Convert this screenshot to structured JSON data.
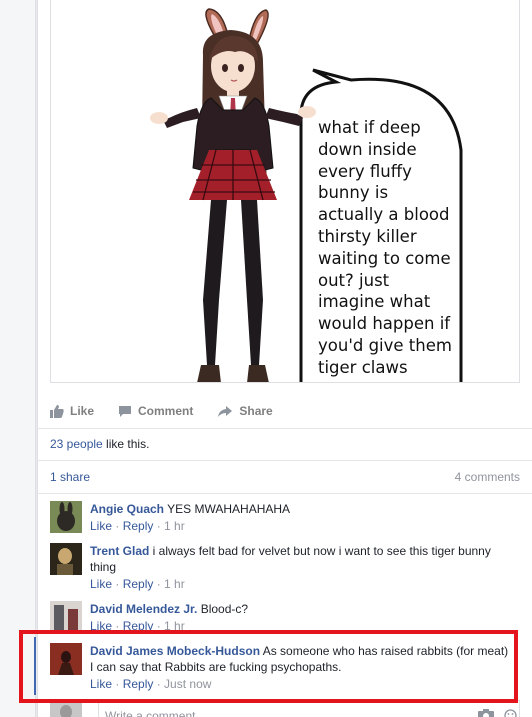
{
  "post": {
    "speech_bubble_lines": [
      "what if deep",
      "down inside",
      "every fluffy",
      "bunny is",
      "actually a blood",
      "thirsty killer",
      "waiting to come",
      "out? just",
      "imagine what",
      "would happen if",
      "you'd give them",
      "tiger claws"
    ]
  },
  "actions": {
    "like": "Like",
    "comment": "Comment",
    "share": "Share"
  },
  "likes": {
    "people": "23 people",
    "suffix": " like this."
  },
  "stats": {
    "shares": "1 share",
    "comments": "4 comments"
  },
  "comments": [
    {
      "author": "Angie Quach",
      "text": " YES MWAHAHAHAHA",
      "like": "Like",
      "reply": "Reply",
      "time": "1 hr"
    },
    {
      "author": "Trent Glad",
      "text": " i always felt bad for velvet but now i want to see this tiger bunny thing",
      "like": "Like",
      "reply": "Reply",
      "time": "1 hr"
    },
    {
      "author": "David Melendez Jr.",
      "text": " Blood-c?",
      "like": "Like",
      "reply": "Reply",
      "time": "1 hr"
    },
    {
      "author": "David James Mobeck-Hudson",
      "text": " As someone who has raised rabbits (for meat) I can say that Rabbits are fucking psychopaths.",
      "like": "Like",
      "reply": "Reply",
      "time": "Just now"
    }
  ],
  "write_comment": {
    "placeholder": "Write a comment..."
  },
  "colors": {
    "link": "#365899",
    "highlight": "#e3141b",
    "muted": "#90949c"
  }
}
